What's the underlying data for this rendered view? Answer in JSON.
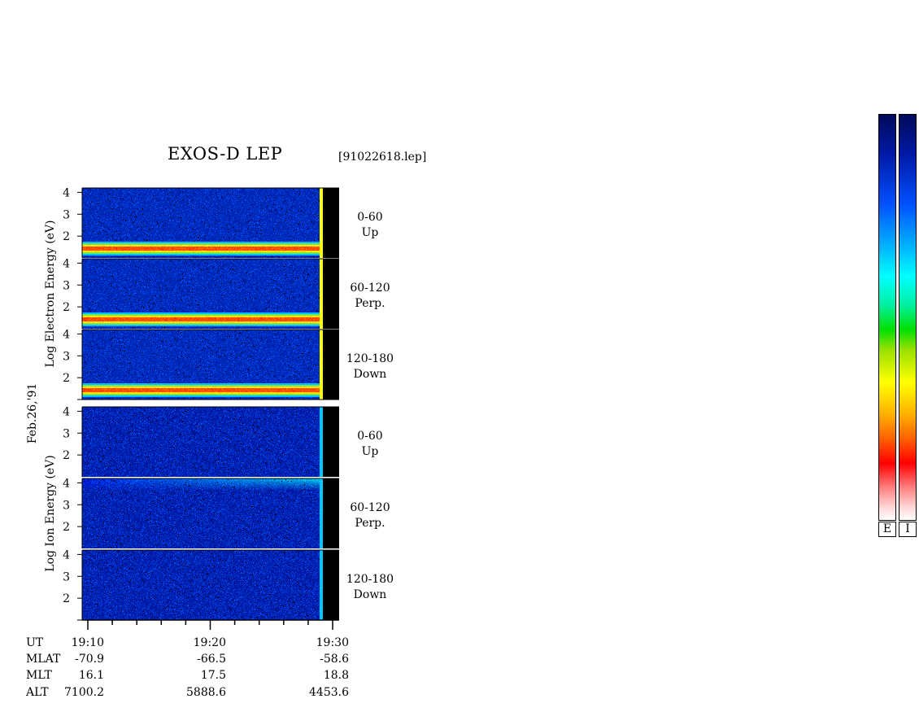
{
  "title": "EXOS-D LEP",
  "filename": "[91022618.lep]",
  "date_label": "Feb.26,'91",
  "colorbar_labels": [
    "E",
    "I"
  ],
  "chart_data": {
    "type": "heatmap",
    "x_axis": {
      "range": [
        "19:10",
        "19:30"
      ],
      "tick_labels": [
        "19:10",
        "19:20",
        "19:30"
      ]
    },
    "species": [
      {
        "ylabel_words": [
          "Log",
          "Electron",
          "Energy",
          "(eV)"
        ],
        "panels": [
          {
            "angle": "0-60",
            "direction": "Up",
            "yticks": [
              "4",
              "3",
              "2"
            ]
          },
          {
            "angle": "60-120",
            "direction": "Perp.",
            "yticks": [
              "4",
              "3",
              "2"
            ]
          },
          {
            "angle": "120-180",
            "direction": "Down",
            "yticks": [
              "4",
              "3",
              "2"
            ]
          }
        ]
      },
      {
        "ylabel_words": [
          "Log",
          "Ion",
          "Energy",
          "(eV)"
        ],
        "panels": [
          {
            "angle": "0-60",
            "direction": "Up",
            "yticks": [
              "4",
              "3",
              "2"
            ]
          },
          {
            "angle": "60-120",
            "direction": "Perp.",
            "yticks": [
              "4",
              "3",
              "2"
            ]
          },
          {
            "angle": "120-180",
            "direction": "Down",
            "yticks": [
              "4",
              "3",
              "2"
            ]
          }
        ]
      }
    ],
    "ephemeris": {
      "rows": [
        {
          "label": "UT",
          "values": [
            "19:10",
            "19:20",
            "19:30"
          ]
        },
        {
          "label": "MLAT",
          "values": [
            "-70.9",
            "-66.5",
            "-58.6"
          ]
        },
        {
          "label": "MLT",
          "values": [
            "16.1",
            "17.5",
            "18.8"
          ]
        },
        {
          "label": "ALT",
          "values": [
            "7100.2",
            "5888.6",
            "4453.6"
          ]
        }
      ]
    },
    "colors": {
      "background": "#000a5a",
      "low": "#0028d0",
      "mid": "#00c8ff",
      "high": "#ffff00",
      "peak": "#ff2000",
      "gap": "#000000"
    }
  }
}
